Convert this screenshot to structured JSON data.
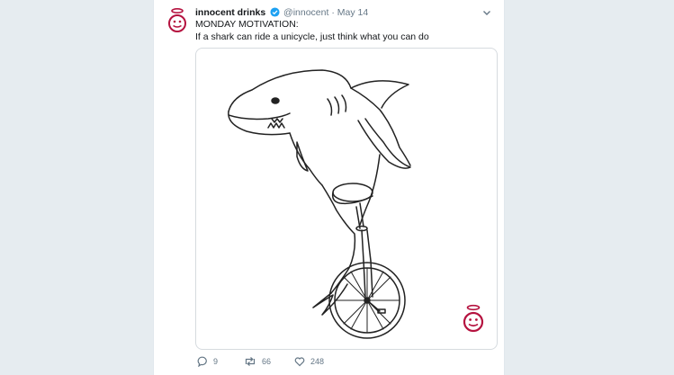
{
  "tweet": {
    "display_name": "innocent drinks",
    "verified_icon": "verified-badge-icon",
    "handle": "@innocent",
    "separator": "·",
    "date": "May 14",
    "text_line1": "MONDAY MOTIVATION:",
    "text_line2": "If a shark can ride a unicycle, just think what you can do",
    "image": {
      "subject": "shark-riding-unicycle-illustration",
      "watermark": "innocent-logo"
    },
    "actions": {
      "reply_count": "9",
      "retweet_count": "66",
      "like_count": "248"
    }
  },
  "colors": {
    "page_background": "#e6ecf0",
    "card_background": "#ffffff",
    "brand": "#b5123f",
    "verified": "#1da1f2",
    "secondary_text": "#657786"
  }
}
